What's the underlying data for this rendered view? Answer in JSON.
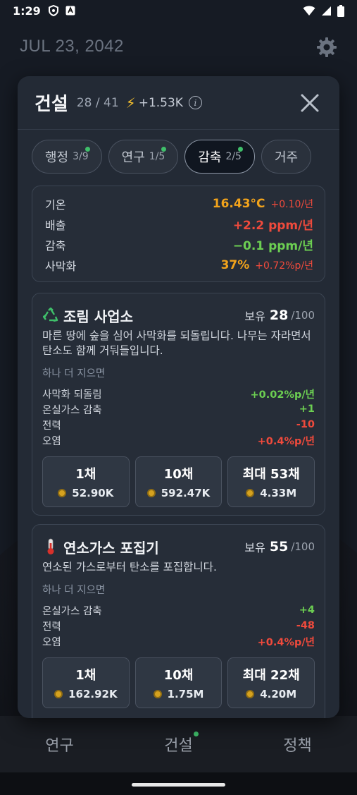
{
  "status_bar": {
    "time": "1:29"
  },
  "background": {
    "date": "JUL 23, 2042",
    "nav": [
      {
        "label": "연구"
      },
      {
        "label": "건설"
      },
      {
        "label": "정책"
      }
    ]
  },
  "modal": {
    "title": "건설",
    "count": "28 / 41",
    "rate": "+1.53K",
    "tabs": [
      {
        "label": "행정",
        "count": "3/9",
        "dot": true,
        "active": false
      },
      {
        "label": "연구",
        "count": "1/5",
        "dot": true,
        "active": false
      },
      {
        "label": "감축",
        "count": "2/5",
        "dot": true,
        "active": true
      },
      {
        "label": "거주",
        "count": "",
        "dot": false,
        "active": false
      }
    ],
    "stats": [
      {
        "label": "기온",
        "value": "16.43°C",
        "sub": "+0.10/년",
        "value_color": "#f2a31b",
        "sub_color": "#ef4a3c"
      },
      {
        "label": "배출",
        "value": "+2.2 ppm/년",
        "sub": "",
        "value_color": "#ef4a3c",
        "sub_color": ""
      },
      {
        "label": "감축",
        "value": "−0.1 ppm/년",
        "sub": "",
        "value_color": "#6ccf52",
        "sub_color": ""
      },
      {
        "label": "사막화",
        "value": "37%",
        "sub": "+0.72%p/년",
        "value_color": "#f2a31b",
        "sub_color": "#ef4a3c"
      }
    ],
    "buildings": [
      {
        "icon": "recycle-icon",
        "icon_glyph": "♻️",
        "name": "조림 사업소",
        "owned_label": "보유",
        "owned": "28",
        "max": "/100",
        "desc": "마른 땅에 숲을 심어 사막화를 되돌립니다. 나무는 자라면서 탄소도 함께 거둬들입니다.",
        "next_label": "하나 더 지으면",
        "effects": [
          {
            "label": "사막화 되돌림",
            "value": "+0.02%p/년",
            "color": "#6ccf52"
          },
          {
            "label": "온실가스 감축",
            "value": "+1",
            "color": "#6ccf52"
          },
          {
            "label": "전력",
            "value": "-10",
            "color": "#ef4a3c"
          },
          {
            "label": "오염",
            "value": "+0.4%p/년",
            "color": "#ef4a3c"
          }
        ],
        "buy": [
          {
            "qty": "1채",
            "cost": "52.90K"
          },
          {
            "qty": "10채",
            "cost": "592.47K"
          },
          {
            "qty": "최대 53채",
            "cost": "4.33M"
          }
        ]
      },
      {
        "icon": "thermometer-icon",
        "icon_glyph": "🌡",
        "name": "연소가스 포집기",
        "owned_label": "보유",
        "owned": "55",
        "max": "/100",
        "desc": "연소된 가스로부터 탄소를 포집합니다.",
        "next_label": "하나 더 지으면",
        "effects": [
          {
            "label": "온실가스 감축",
            "value": "+4",
            "color": "#6ccf52"
          },
          {
            "label": "전력",
            "value": "-48",
            "color": "#ef4a3c"
          },
          {
            "label": "오염",
            "value": "+0.4%p/년",
            "color": "#ef4a3c"
          }
        ],
        "buy": [
          {
            "qty": "1채",
            "cost": "162.92K"
          },
          {
            "qty": "10채",
            "cost": "1.75M"
          },
          {
            "qty": "최대 22채",
            "cost": "4.20M"
          }
        ]
      }
    ]
  }
}
